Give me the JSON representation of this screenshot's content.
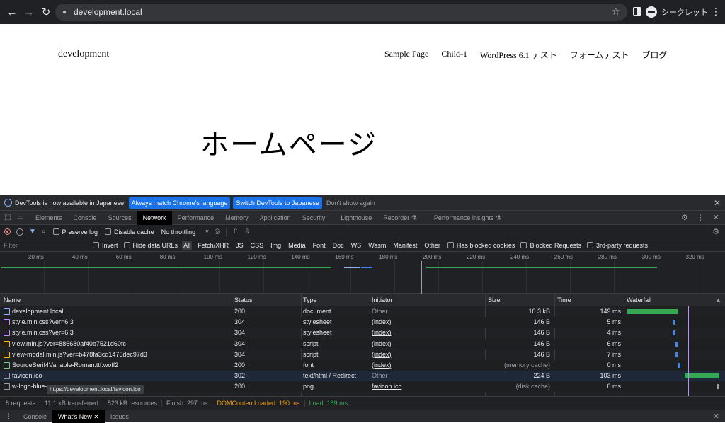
{
  "browser": {
    "url": "development.local",
    "profile_label": "シークレット"
  },
  "site": {
    "title": "development",
    "nav": [
      "Sample Page",
      "Child-1",
      "WordPress 6.1 テスト",
      "フォームテスト",
      "ブログ"
    ],
    "hero": "ホームページ"
  },
  "devtools": {
    "infobar": {
      "message": "DevTools is now available in Japanese!",
      "btn_match": "Always match Chrome's language",
      "btn_switch": "Switch DevTools to Japanese",
      "btn_dismiss": "Don't show again"
    },
    "tabs": [
      "Elements",
      "Console",
      "Sources",
      "Network",
      "Performance",
      "Memory",
      "Application",
      "Security",
      "Lighthouse",
      "Recorder ⚗",
      "Performance insights ⚗"
    ],
    "active_tab": "Network",
    "toolbar": {
      "preserve_log": "Preserve log",
      "disable_cache": "Disable cache",
      "throttling": "No throttling"
    },
    "filter": {
      "placeholder": "Filter",
      "invert": "Invert",
      "hide_data_urls": "Hide data URLs",
      "types": [
        "All",
        "Fetch/XHR",
        "JS",
        "CSS",
        "Img",
        "Media",
        "Font",
        "Doc",
        "WS",
        "Wasm",
        "Manifest",
        "Other"
      ],
      "has_blocked_cookies": "Has blocked cookies",
      "blocked_requests": "Blocked Requests",
      "third_party": "3rd-party requests"
    },
    "overview_ticks": [
      "20 ms",
      "40 ms",
      "60 ms",
      "80 ms",
      "100 ms",
      "120 ms",
      "140 ms",
      "160 ms",
      "180 ms",
      "200 ms",
      "220 ms",
      "240 ms",
      "260 ms",
      "280 ms",
      "300 ms",
      "320 ms"
    ],
    "columns": [
      "Name",
      "Status",
      "Type",
      "Initiator",
      "Size",
      "Time",
      "Waterfall"
    ],
    "rows": [
      {
        "name": "development.local",
        "status": "200",
        "type": "document",
        "initiator": "Other",
        "size": "10.3 kB",
        "time": "149 ms",
        "icon": "document-icon",
        "icon_color": "#8ab4f8"
      },
      {
        "name": "style.min.css?ver=6.3",
        "status": "304",
        "type": "stylesheet",
        "initiator": "(index)",
        "size": "146 B",
        "time": "5 ms",
        "icon": "stylesheet-icon",
        "icon_color": "#c58af9"
      },
      {
        "name": "style.min.css?ver=6.3",
        "status": "304",
        "type": "stylesheet",
        "initiator": "(index)",
        "size": "146 B",
        "time": "4 ms",
        "icon": "stylesheet-icon",
        "icon_color": "#c58af9"
      },
      {
        "name": "view.min.js?ver=886680af40b7521d60fc",
        "status": "304",
        "type": "script",
        "initiator": "(index)",
        "size": "146 B",
        "time": "6 ms",
        "icon": "script-icon",
        "icon_color": "#fbbc04"
      },
      {
        "name": "view-modal.min.js?ver=b478fa3cd1475dec97d3",
        "status": "304",
        "type": "script",
        "initiator": "(index)",
        "size": "146 B",
        "time": "7 ms",
        "icon": "script-icon",
        "icon_color": "#fbbc04"
      },
      {
        "name": "SourceSerif4Variable-Roman.ttf.woff2",
        "status": "200",
        "type": "font",
        "initiator": "(index)",
        "size": "(memory cache)",
        "time": "0 ms",
        "icon": "font-icon",
        "icon_color": "#81c995"
      },
      {
        "name": "favicon.ico",
        "status": "302",
        "type": "text/html / Redirect",
        "initiator": "Other",
        "size": "224 B",
        "time": "103 ms",
        "icon": "file-icon",
        "icon_color": "#9aa0a6"
      },
      {
        "name": "w-logo-blue-",
        "status": "200",
        "type": "png",
        "initiator": "favicon.ico",
        "size": "(disk cache)",
        "time": "0 ms",
        "icon": "file-icon",
        "icon_color": "#9aa0a6"
      }
    ],
    "tooltip": "https://development.local/favicon.ico",
    "status": {
      "requests": "8 requests",
      "transferred": "11.1 kB transferred",
      "resources": "523 kB resources",
      "finish": "Finish: 297 ms",
      "dcl": "DOMContentLoaded: 190 ms",
      "load": "Load: 189 ms"
    },
    "drawer_tabs": [
      "Console",
      "What's New",
      "Issues"
    ],
    "drawer_active": "What's New",
    "colors": {
      "dcl": "#f29900",
      "load": "#34a853",
      "waterfall_green": "#34a853",
      "waterfall_blue": "#4285f4"
    }
  }
}
